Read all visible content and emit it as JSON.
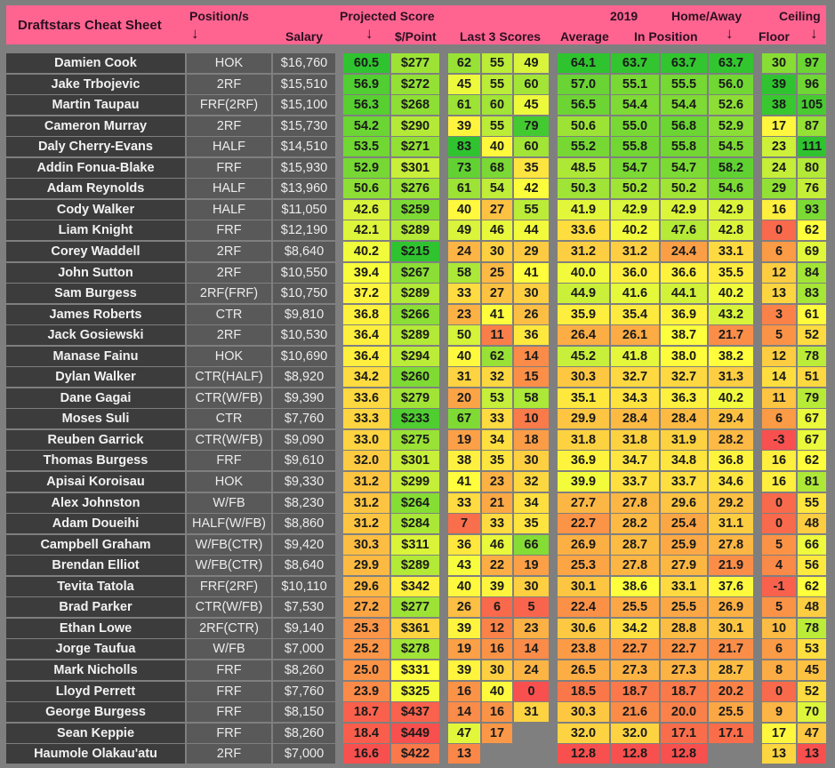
{
  "header": {
    "title": "Draftstars Cheat Sheet",
    "position": "Position/s",
    "salary": "Salary",
    "projected_group": "Projected Score",
    "per_point": "$/Point",
    "last3": "Last 3 Scores",
    "year": "2019",
    "average": "Average",
    "in_position": "In Position",
    "home_away": "Home/Away",
    "floor": "Floor",
    "ceiling": "Ceiling",
    "sort_arrow": "↓"
  },
  "scale_colors": {
    "low": "#f8504e",
    "mid": "#ffff3c",
    "high": "#2fc42f"
  },
  "players": [
    {
      "name": "Damien Cook",
      "pos": "HOK",
      "salary": "$16,760",
      "proj": "60.5",
      "ppp": "$277",
      "l1": "62",
      "l2": "55",
      "l3": "49",
      "avg": "64.1",
      "inpos": "63.7",
      "ha1": "63.7",
      "ha2": "63.7",
      "floor": "30",
      "ceil": "97"
    },
    {
      "name": "Jake Trbojevic",
      "pos": "2RF",
      "salary": "$15,510",
      "proj": "56.9",
      "ppp": "$272",
      "l1": "45",
      "l2": "55",
      "l3": "60",
      "avg": "57.0",
      "inpos": "55.1",
      "ha1": "55.5",
      "ha2": "56.0",
      "floor": "39",
      "ceil": "96"
    },
    {
      "name": "Martin Taupau",
      "pos": "FRF(2RF)",
      "salary": "$15,100",
      "proj": "56.3",
      "ppp": "$268",
      "l1": "61",
      "l2": "60",
      "l3": "45",
      "avg": "56.5",
      "inpos": "54.4",
      "ha1": "54.4",
      "ha2": "52.6",
      "floor": "38",
      "ceil": "105"
    },
    {
      "name": "Cameron Murray",
      "pos": "2RF",
      "salary": "$15,730",
      "proj": "54.2",
      "ppp": "$290",
      "l1": "39",
      "l2": "55",
      "l3": "79",
      "avg": "50.6",
      "inpos": "55.0",
      "ha1": "56.8",
      "ha2": "52.9",
      "floor": "17",
      "ceil": "87"
    },
    {
      "name": "Daly Cherry-Evans",
      "pos": "HALF",
      "salary": "$14,510",
      "proj": "53.5",
      "ppp": "$271",
      "l1": "83",
      "l2": "40",
      "l3": "60",
      "avg": "55.2",
      "inpos": "55.8",
      "ha1": "55.8",
      "ha2": "54.5",
      "floor": "23",
      "ceil": "111"
    },
    {
      "name": "Addin Fonua-Blake",
      "pos": "FRF",
      "salary": "$15,930",
      "proj": "52.9",
      "ppp": "$301",
      "l1": "73",
      "l2": "68",
      "l3": "35",
      "avg": "48.5",
      "inpos": "54.7",
      "ha1": "54.7",
      "ha2": "58.2",
      "floor": "24",
      "ceil": "80"
    },
    {
      "name": "Adam Reynolds",
      "pos": "HALF",
      "salary": "$13,960",
      "proj": "50.6",
      "ppp": "$276",
      "l1": "61",
      "l2": "54",
      "l3": "42",
      "avg": "50.3",
      "inpos": "50.2",
      "ha1": "50.2",
      "ha2": "54.6",
      "floor": "29",
      "ceil": "76"
    },
    {
      "name": "Cody Walker",
      "pos": "HALF",
      "salary": "$11,050",
      "proj": "42.6",
      "ppp": "$259",
      "l1": "40",
      "l2": "27",
      "l3": "55",
      "avg": "41.9",
      "inpos": "42.9",
      "ha1": "42.9",
      "ha2": "42.9",
      "floor": "16",
      "ceil": "93"
    },
    {
      "name": "Liam Knight",
      "pos": "FRF",
      "salary": "$12,190",
      "proj": "42.1",
      "ppp": "$289",
      "l1": "49",
      "l2": "46",
      "l3": "44",
      "avg": "33.6",
      "inpos": "40.2",
      "ha1": "47.6",
      "ha2": "42.8",
      "floor": "0",
      "ceil": "62"
    },
    {
      "name": "Corey Waddell",
      "pos": "2RF",
      "salary": "$8,640",
      "proj": "40.2",
      "ppp": "$215",
      "l1": "24",
      "l2": "30",
      "l3": "29",
      "avg": "31.2",
      "inpos": "31.2",
      "ha1": "24.4",
      "ha2": "33.1",
      "floor": "6",
      "ceil": "69"
    },
    {
      "name": "John Sutton",
      "pos": "2RF",
      "salary": "$10,550",
      "proj": "39.4",
      "ppp": "$267",
      "l1": "58",
      "l2": "25",
      "l3": "41",
      "avg": "40.0",
      "inpos": "36.0",
      "ha1": "36.6",
      "ha2": "35.5",
      "floor": "12",
      "ceil": "84"
    },
    {
      "name": "Sam Burgess",
      "pos": "2RF(FRF)",
      "salary": "$10,750",
      "proj": "37.2",
      "ppp": "$289",
      "l1": "33",
      "l2": "27",
      "l3": "30",
      "avg": "44.9",
      "inpos": "41.6",
      "ha1": "44.1",
      "ha2": "40.2",
      "floor": "13",
      "ceil": "83"
    },
    {
      "name": "James Roberts",
      "pos": "CTR",
      "salary": "$9,810",
      "proj": "36.8",
      "ppp": "$266",
      "l1": "23",
      "l2": "41",
      "l3": "26",
      "avg": "35.9",
      "inpos": "35.4",
      "ha1": "36.9",
      "ha2": "43.2",
      "floor": "3",
      "ceil": "61"
    },
    {
      "name": "Jack Gosiewski",
      "pos": "2RF",
      "salary": "$10,530",
      "proj": "36.4",
      "ppp": "$289",
      "l1": "50",
      "l2": "11",
      "l3": "36",
      "avg": "26.4",
      "inpos": "26.1",
      "ha1": "38.7",
      "ha2": "21.7",
      "floor": "5",
      "ceil": "52"
    },
    {
      "name": "Manase Fainu",
      "pos": "HOK",
      "salary": "$10,690",
      "proj": "36.4",
      "ppp": "$294",
      "l1": "40",
      "l2": "62",
      "l3": "14",
      "avg": "45.2",
      "inpos": "41.8",
      "ha1": "38.0",
      "ha2": "38.2",
      "floor": "12",
      "ceil": "78"
    },
    {
      "name": "Dylan Walker",
      "pos": "CTR(HALF)",
      "salary": "$8,920",
      "proj": "34.2",
      "ppp": "$260",
      "l1": "31",
      "l2": "32",
      "l3": "15",
      "avg": "30.3",
      "inpos": "32.7",
      "ha1": "32.7",
      "ha2": "31.3",
      "floor": "14",
      "ceil": "51"
    },
    {
      "name": "Dane Gagai",
      "pos": "CTR(W/FB)",
      "salary": "$9,390",
      "proj": "33.6",
      "ppp": "$279",
      "l1": "20",
      "l2": "53",
      "l3": "58",
      "avg": "35.1",
      "inpos": "34.3",
      "ha1": "36.3",
      "ha2": "40.2",
      "floor": "11",
      "ceil": "79"
    },
    {
      "name": "Moses Suli",
      "pos": "CTR",
      "salary": "$7,760",
      "proj": "33.3",
      "ppp": "$233",
      "l1": "67",
      "l2": "33",
      "l3": "10",
      "avg": "29.9",
      "inpos": "28.4",
      "ha1": "28.4",
      "ha2": "29.4",
      "floor": "6",
      "ceil": "67"
    },
    {
      "name": "Reuben Garrick",
      "pos": "CTR(W/FB)",
      "salary": "$9,090",
      "proj": "33.0",
      "ppp": "$275",
      "l1": "19",
      "l2": "34",
      "l3": "18",
      "avg": "31.8",
      "inpos": "31.8",
      "ha1": "31.9",
      "ha2": "28.2",
      "floor": "-3",
      "ceil": "67"
    },
    {
      "name": "Thomas Burgess",
      "pos": "FRF",
      "salary": "$9,610",
      "proj": "32.0",
      "ppp": "$301",
      "l1": "38",
      "l2": "35",
      "l3": "30",
      "avg": "36.9",
      "inpos": "34.7",
      "ha1": "34.8",
      "ha2": "36.8",
      "floor": "16",
      "ceil": "62"
    },
    {
      "name": "Apisai Koroisau",
      "pos": "HOK",
      "salary": "$9,330",
      "proj": "31.2",
      "ppp": "$299",
      "l1": "41",
      "l2": "23",
      "l3": "32",
      "avg": "39.9",
      "inpos": "33.7",
      "ha1": "33.7",
      "ha2": "34.6",
      "floor": "16",
      "ceil": "81"
    },
    {
      "name": "Alex Johnston",
      "pos": "W/FB",
      "salary": "$8,230",
      "proj": "31.2",
      "ppp": "$264",
      "l1": "33",
      "l2": "21",
      "l3": "34",
      "avg": "27.7",
      "inpos": "27.8",
      "ha1": "29.6",
      "ha2": "29.2",
      "floor": "0",
      "ceil": "55"
    },
    {
      "name": "Adam Doueihi",
      "pos": "HALF(W/FB)",
      "salary": "$8,860",
      "proj": "31.2",
      "ppp": "$284",
      "l1": "7",
      "l2": "33",
      "l3": "35",
      "avg": "22.7",
      "inpos": "28.2",
      "ha1": "25.4",
      "ha2": "31.1",
      "floor": "0",
      "ceil": "48"
    },
    {
      "name": "Campbell Graham",
      "pos": "W/FB(CTR)",
      "salary": "$9,420",
      "proj": "30.3",
      "ppp": "$311",
      "l1": "36",
      "l2": "46",
      "l3": "66",
      "avg": "26.9",
      "inpos": "28.7",
      "ha1": "25.9",
      "ha2": "27.8",
      "floor": "5",
      "ceil": "66"
    },
    {
      "name": "Brendan Elliot",
      "pos": "W/FB(CTR)",
      "salary": "$8,640",
      "proj": "29.9",
      "ppp": "$289",
      "l1": "43",
      "l2": "22",
      "l3": "19",
      "avg": "25.3",
      "inpos": "27.8",
      "ha1": "27.9",
      "ha2": "21.9",
      "floor": "4",
      "ceil": "56"
    },
    {
      "name": "Tevita Tatola",
      "pos": "FRF(2RF)",
      "salary": "$10,110",
      "proj": "29.6",
      "ppp": "$342",
      "l1": "40",
      "l2": "39",
      "l3": "30",
      "avg": "30.1",
      "inpos": "38.6",
      "ha1": "33.1",
      "ha2": "37.6",
      "floor": "-1",
      "ceil": "62"
    },
    {
      "name": "Brad Parker",
      "pos": "CTR(W/FB)",
      "salary": "$7,530",
      "proj": "27.2",
      "ppp": "$277",
      "l1": "26",
      "l2": "6",
      "l3": "5",
      "avg": "22.4",
      "inpos": "25.5",
      "ha1": "25.5",
      "ha2": "26.9",
      "floor": "5",
      "ceil": "48"
    },
    {
      "name": "Ethan Lowe",
      "pos": "2RF(CTR)",
      "salary": "$9,140",
      "proj": "25.3",
      "ppp": "$361",
      "l1": "39",
      "l2": "12",
      "l3": "23",
      "avg": "30.6",
      "inpos": "34.2",
      "ha1": "28.8",
      "ha2": "30.1",
      "floor": "10",
      "ceil": "78"
    },
    {
      "name": "Jorge Taufua",
      "pos": "W/FB",
      "salary": "$7,000",
      "proj": "25.2",
      "ppp": "$278",
      "l1": "19",
      "l2": "16",
      "l3": "14",
      "avg": "23.8",
      "inpos": "22.7",
      "ha1": "22.7",
      "ha2": "21.7",
      "floor": "6",
      "ceil": "53"
    },
    {
      "name": "Mark Nicholls",
      "pos": "FRF",
      "salary": "$8,260",
      "proj": "25.0",
      "ppp": "$331",
      "l1": "39",
      "l2": "30",
      "l3": "24",
      "avg": "26.5",
      "inpos": "27.3",
      "ha1": "27.3",
      "ha2": "28.7",
      "floor": "8",
      "ceil": "45"
    },
    {
      "name": "Lloyd Perrett",
      "pos": "FRF",
      "salary": "$7,760",
      "proj": "23.9",
      "ppp": "$325",
      "l1": "16",
      "l2": "40",
      "l3": "0",
      "avg": "18.5",
      "inpos": "18.7",
      "ha1": "18.7",
      "ha2": "20.2",
      "floor": "0",
      "ceil": "52"
    },
    {
      "name": "George Burgess",
      "pos": "FRF",
      "salary": "$8,150",
      "proj": "18.7",
      "ppp": "$437",
      "l1": "14",
      "l2": "16",
      "l3": "31",
      "avg": "30.3",
      "inpos": "21.6",
      "ha1": "20.0",
      "ha2": "25.5",
      "floor": "9",
      "ceil": "70"
    },
    {
      "name": "Sean Keppie",
      "pos": "FRF",
      "salary": "$8,260",
      "proj": "18.4",
      "ppp": "$449",
      "l1": "47",
      "l2": "17",
      "l3": "",
      "avg": "32.0",
      "inpos": "32.0",
      "ha1": "17.1",
      "ha2": "17.1",
      "floor": "17",
      "ceil": "47"
    },
    {
      "name": "Haumole Olakau'atu",
      "pos": "2RF",
      "salary": "$7,000",
      "proj": "16.6",
      "ppp": "$422",
      "l1": "13",
      "l2": "",
      "l3": "",
      "avg": "12.8",
      "inpos": "12.8",
      "ha1": "12.8",
      "ha2": "",
      "floor": "13",
      "ceil": "13"
    }
  ]
}
